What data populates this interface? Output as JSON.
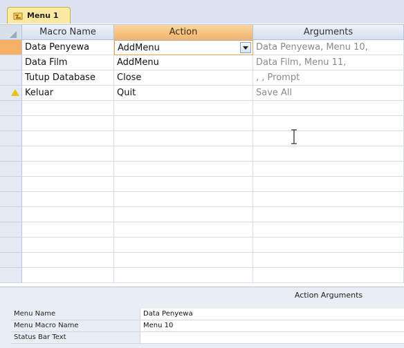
{
  "tab": {
    "label": "Menu 1",
    "icon": "macro-icon"
  },
  "columns": {
    "macro_name": "Macro Name",
    "action": "Action",
    "arguments": "Arguments"
  },
  "rows": [
    {
      "macro_name": "Data Penyewa",
      "action": "AddMenu",
      "arguments": "Data Penyewa, Menu 10,"
    },
    {
      "macro_name": "Data Film",
      "action": "AddMenu",
      "arguments": "Data Film, Menu 11,"
    },
    {
      "macro_name": "Tutup Database",
      "action": "Close",
      "arguments": ", , Prompt"
    },
    {
      "macro_name": "Keluar",
      "action": "Quit",
      "arguments": "Save All"
    }
  ],
  "action_arguments": {
    "title": "Action Arguments",
    "fields": [
      {
        "label": "Menu Name",
        "value": "Data Penyewa"
      },
      {
        "label": "Menu Macro Name",
        "value": "Menu 10"
      },
      {
        "label": "Status Bar Text",
        "value": ""
      }
    ]
  },
  "colors": {
    "selected_header": "#f3b46a",
    "tab": "#fbe9a3",
    "warning": "#e8c21b"
  }
}
